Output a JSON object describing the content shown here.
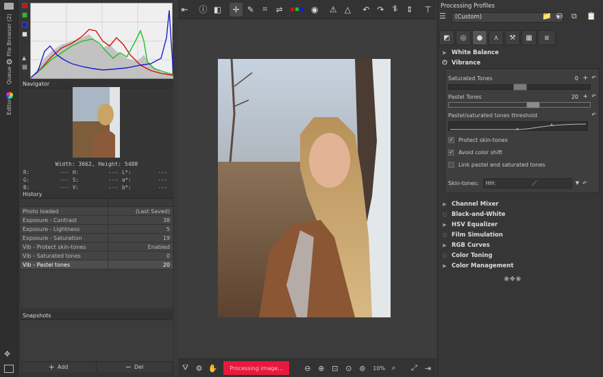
{
  "vtabs": {
    "file_browser": "File Browser (2)",
    "queue": "Queue",
    "editor": "Editor"
  },
  "navigator": {
    "title": "Navigator",
    "size_label": "Width: 3662, Height: 5488",
    "values": [
      [
        {
          "k": "R:",
          "v": "---"
        },
        {
          "k": "H:",
          "v": "---"
        },
        {
          "k": "L*:",
          "v": "---"
        }
      ],
      [
        {
          "k": "G:",
          "v": "---"
        },
        {
          "k": "S:",
          "v": "---"
        },
        {
          "k": "a*:",
          "v": "---"
        }
      ],
      [
        {
          "k": "B:",
          "v": "---"
        },
        {
          "k": "V:",
          "v": "---"
        },
        {
          "k": "b*:",
          "v": "---"
        }
      ]
    ]
  },
  "history": {
    "title": "History",
    "rows": [
      {
        "label": "Photo loaded",
        "value": "(Last Saved)"
      },
      {
        "label": "Exposure - Contrast",
        "value": "38"
      },
      {
        "label": "Exposure - Lightness",
        "value": "5"
      },
      {
        "label": "Exposure - Saturation",
        "value": "19"
      },
      {
        "label": "Vib - Protect skin-tones",
        "value": "Enabled"
      },
      {
        "label": "Vib - Saturated tones",
        "value": "0"
      },
      {
        "label": "Vib - Pastel tones",
        "value": "20"
      }
    ]
  },
  "snapshots": {
    "title": "Snapshots",
    "add_label": "Add",
    "del_label": "Del"
  },
  "bottombar": {
    "progress_label": "Processing image...",
    "zoom": "10%"
  },
  "profiles": {
    "title": "Processing Profiles",
    "selected": "(Custom)"
  },
  "sections_top": [
    {
      "label": "White Balance"
    },
    {
      "label": "Vibrance"
    }
  ],
  "vibrance": {
    "saturated_label": "Saturated Tones",
    "saturated_value": "0",
    "saturated_level": 0.5,
    "pastel_label": "Pastel Tones",
    "pastel_value": "20",
    "pastel_level": 0.6,
    "threshold_label": "Pastel/saturated tones threshold",
    "protect_label": "Protect skin-tones",
    "protect_checked": true,
    "avoid_label": "Avoid color shift",
    "avoid_checked": true,
    "link_label": "Link pastel and saturated tones",
    "link_checked": false,
    "skin_label": "Skin-tones:",
    "skin_field": "HH:"
  },
  "sections_bottom": [
    {
      "label": "Channel Mixer"
    },
    {
      "label": "Black-and-White"
    },
    {
      "label": "HSV Equalizer"
    },
    {
      "label": "Film Simulation"
    },
    {
      "label": "RGB Curves"
    },
    {
      "label": "Color Toning"
    },
    {
      "label": "Color Management"
    }
  ],
  "colors": {
    "progress": "#e8193f",
    "hist_red": "#d01010",
    "hist_green": "#20c020",
    "hist_blue": "#1a1ad0"
  }
}
